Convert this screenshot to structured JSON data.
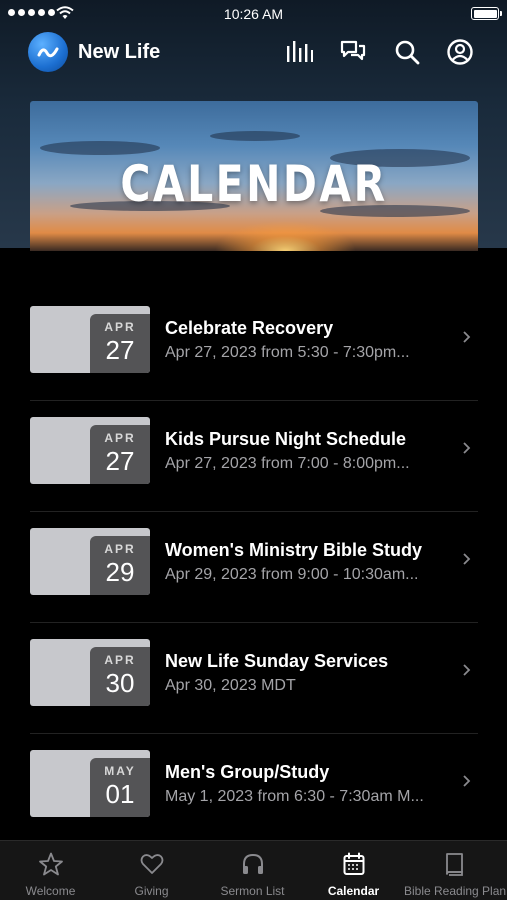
{
  "status_bar": {
    "time": "10:26 AM"
  },
  "header": {
    "app_name": "New Life"
  },
  "banner": {
    "title": "CALENDAR"
  },
  "events": [
    {
      "month": "APR",
      "day": "27",
      "title": "Celebrate Recovery",
      "subtitle": "Apr 27, 2023 from 5:30 - 7:30pm..."
    },
    {
      "month": "APR",
      "day": "27",
      "title": "Kids Pursue Night Schedule",
      "subtitle": "Apr 27, 2023 from 7:00 - 8:00pm..."
    },
    {
      "month": "APR",
      "day": "29",
      "title": "Women's Ministry Bible Study",
      "subtitle": "Apr 29, 2023 from 9:00 - 10:30am..."
    },
    {
      "month": "APR",
      "day": "30",
      "title": "New Life Sunday Services",
      "subtitle": "Apr 30, 2023 MDT"
    },
    {
      "month": "MAY",
      "day": "01",
      "title": "Men's Group/Study",
      "subtitle": "May 1, 2023 from 6:30 - 7:30am M..."
    }
  ],
  "tabs": [
    {
      "label": "Welcome",
      "icon": "star-icon"
    },
    {
      "label": "Giving",
      "icon": "heart-icon"
    },
    {
      "label": "Sermon List",
      "icon": "headphones-icon"
    },
    {
      "label": "Calendar",
      "icon": "calendar-icon",
      "active": true
    },
    {
      "label": "Bible Reading Plan",
      "icon": "book-icon"
    }
  ]
}
